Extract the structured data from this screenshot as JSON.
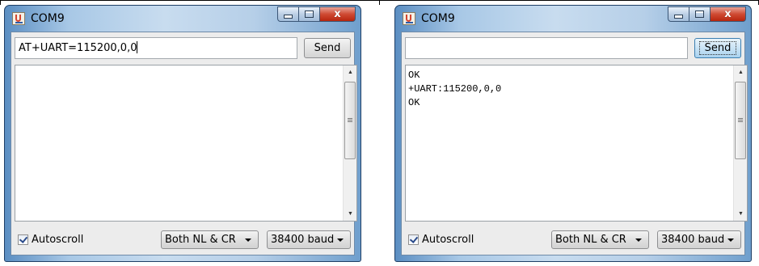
{
  "windows": [
    {
      "title": "COM9",
      "input_value": "AT+UART=115200,0,0",
      "send_label": "Send",
      "output_lines": [],
      "autoscroll_label": "Autoscroll",
      "autoscroll_checked": true,
      "line_ending": "Both NL & CR",
      "baud": "38400 baud",
      "close_glyph": "x"
    },
    {
      "title": "COM9",
      "input_value": "",
      "send_label": "Send",
      "output_lines": [
        "OK",
        "+UART:115200,0,0",
        "OK"
      ],
      "autoscroll_label": "Autoscroll",
      "autoscroll_checked": true,
      "line_ending": "Both NL & CR",
      "baud": "38400 baud",
      "close_glyph": "x"
    }
  ],
  "icons": {
    "app": "arduino-java-icon",
    "minimize": "minimize-icon",
    "maximize": "maximize-icon",
    "close": "close-icon",
    "scroll_up": "scroll-up-arrow-icon",
    "scroll_down": "scroll-down-arrow-icon",
    "dropdown": "chevron-down-icon"
  },
  "colors": {
    "frame_accent": "#a8c8e6",
    "close_button": "#cf4a33",
    "send_focus": "#c9e3f5"
  }
}
